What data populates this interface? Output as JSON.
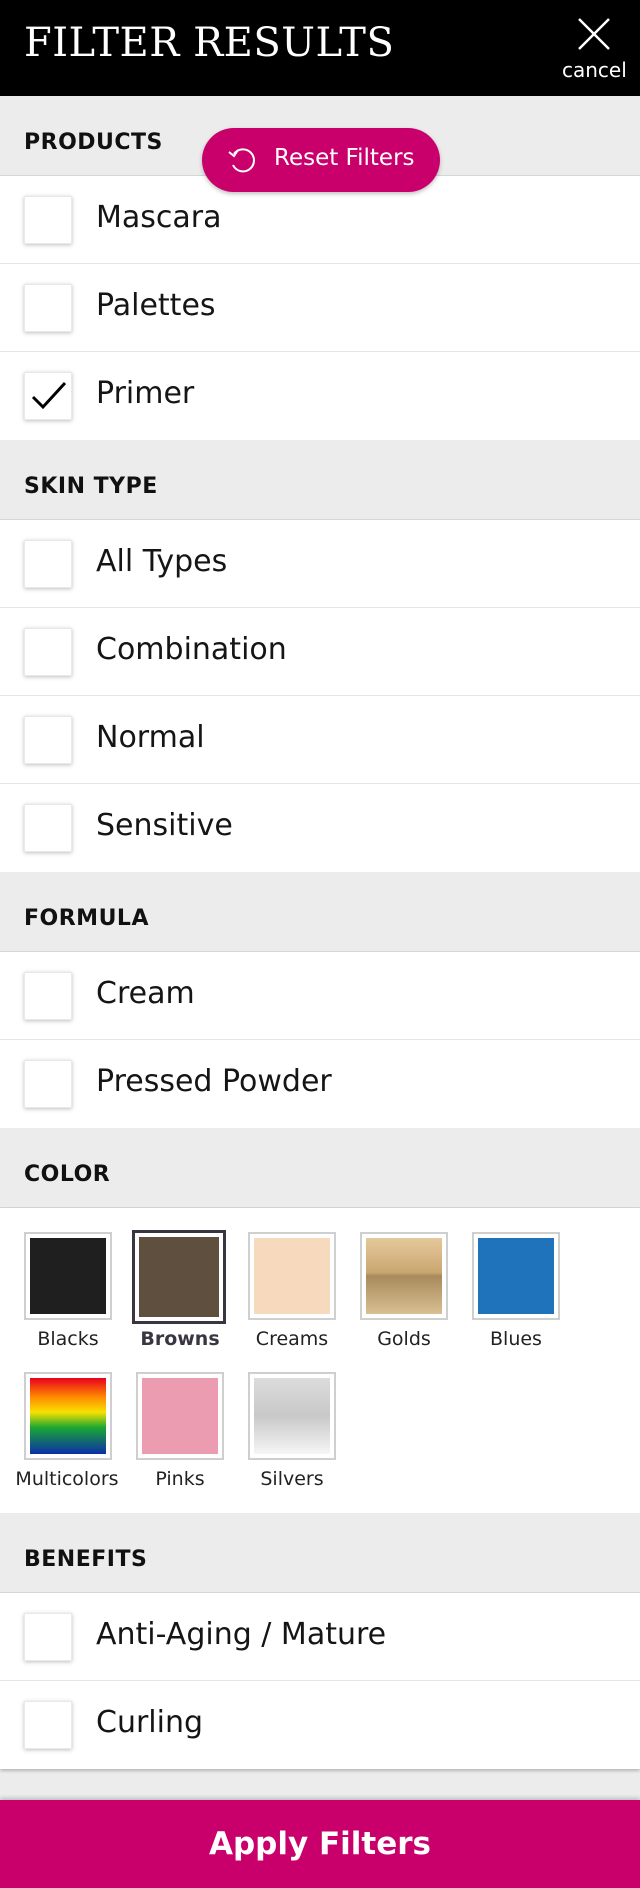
{
  "header": {
    "title": "FILTER RESULTS",
    "cancel_label": "cancel"
  },
  "reset_label": "Reset Filters",
  "sections": {
    "products": {
      "label": "PRODUCTS",
      "items": [
        {
          "label": "Mascara",
          "checked": false
        },
        {
          "label": "Palettes",
          "checked": false
        },
        {
          "label": "Primer",
          "checked": true
        }
      ]
    },
    "skin_type": {
      "label": "SKIN TYPE",
      "items": [
        {
          "label": "All Types",
          "checked": false
        },
        {
          "label": "Combination",
          "checked": false
        },
        {
          "label": "Normal",
          "checked": false
        },
        {
          "label": "Sensitive",
          "checked": false
        }
      ]
    },
    "formula": {
      "label": "FORMULA",
      "items": [
        {
          "label": "Cream",
          "checked": false
        },
        {
          "label": "Pressed Powder",
          "checked": false
        }
      ]
    },
    "color": {
      "label": "COLOR",
      "swatches": [
        {
          "label": "Blacks",
          "color": "#1f1f1f",
          "selected": false
        },
        {
          "label": "Browns",
          "color": "#5e4f3e",
          "selected": true
        },
        {
          "label": "Creams",
          "color": "#f7d9bd",
          "selected": false
        },
        {
          "label": "Golds",
          "color": "linear-gradient(#e5c99b, #caa771 45%, #a88a5c 50%, #d9bf92)",
          "selected": false
        },
        {
          "label": "Blues",
          "color": "#1f73ba",
          "selected": false
        },
        {
          "label": "Multicolors",
          "color": "linear-gradient(#e8001d, #ff8a00 25%, #f7e100 45%, #1ba832 65%, #0b2fa8)",
          "selected": false
        },
        {
          "label": "Pinks",
          "color": "#eb9cb1",
          "selected": false
        },
        {
          "label": "Silvers",
          "color": "linear-gradient(#dcdcdc, #c8c8c8 50%, #f6f6f6)",
          "selected": false
        }
      ]
    },
    "benefits": {
      "label": "BENEFITS",
      "items": [
        {
          "label": "Anti-Aging / Mature",
          "checked": false
        },
        {
          "label": "Curling",
          "checked": false
        }
      ]
    }
  },
  "apply_label": "Apply Filters",
  "colors": {
    "accent": "#c9006b",
    "header_bg": "#000000",
    "section_bg": "#ececec"
  }
}
